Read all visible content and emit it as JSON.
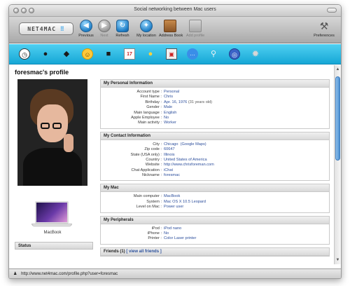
{
  "window": {
    "title": "Social networking between Mac users"
  },
  "toolbar": {
    "logo_text": "NET4MAC",
    "logo_dots": "⠿",
    "buttons": [
      {
        "label": "Previous"
      },
      {
        "label": "Next"
      },
      {
        "label": "Refresh"
      },
      {
        "label": "My location"
      },
      {
        "label": "Address Book"
      },
      {
        "label": "Add profile"
      },
      {
        "label": "Preferences"
      }
    ]
  },
  "iconbar": {
    "icons": [
      "clock-icon",
      "person-icon",
      "people-icon",
      "smiley-icon",
      "user-icon",
      "calendar-icon",
      "lightbulb-icon",
      "inbox-icon",
      "chat-bubble-icon",
      "magnifier-icon",
      "globe-icon",
      "gear-icon"
    ]
  },
  "profile": {
    "heading": "foresmac's profile",
    "mac_label": "MacBook",
    "status_heading": "Status"
  },
  "sections": {
    "personal": {
      "title": "My Personal Information",
      "rows": [
        {
          "k": "Account type :",
          "v": "Personal"
        },
        {
          "k": "First Name :",
          "v": "Chris"
        },
        {
          "k": "Birthday :",
          "v": "Apr. 16, 1976",
          "extra": "(31 years old)"
        },
        {
          "k": "Gender :",
          "v": "Male"
        },
        {
          "k": "Main language :",
          "v": "English"
        },
        {
          "k": "Apple Employee :",
          "v": "No"
        },
        {
          "k": "Main activity :",
          "v": "Worker"
        }
      ]
    },
    "contact": {
      "title": "My Contact Information",
      "rows": [
        {
          "k": "City :",
          "v": "Chicago",
          "extra": "(Google Maps)"
        },
        {
          "k": "Zip code :",
          "v": "60647"
        },
        {
          "k": "State (USA only) :",
          "v": "Illinois"
        },
        {
          "k": "Country :",
          "v": "United States of America"
        },
        {
          "k": "Website :",
          "v": "http://www.chrisforeman.com"
        },
        {
          "k": "Chat Application :",
          "v": "iChat"
        },
        {
          "k": "Nickname :",
          "v": "foresmac"
        }
      ]
    },
    "mac": {
      "title": "My Mac",
      "rows": [
        {
          "k": "Main computer :",
          "v": "MacBook"
        },
        {
          "k": "System :",
          "v": "Mac OS X 10.5 Leopard"
        },
        {
          "k": "Level on Mac :",
          "v": "Power user"
        }
      ]
    },
    "peripherals": {
      "title": "My Peripherals",
      "rows": [
        {
          "k": "iPod :",
          "v": "iPod nano"
        },
        {
          "k": "iPhone :",
          "v": "No"
        },
        {
          "k": "Printer :",
          "v": "Color Laser printer"
        }
      ]
    },
    "friends": {
      "title": "Friends (1)",
      "link": "[ view all friends ]"
    }
  },
  "statusbar": {
    "url": "http://www.net4mac.com/profile.php?user=foresmac"
  }
}
